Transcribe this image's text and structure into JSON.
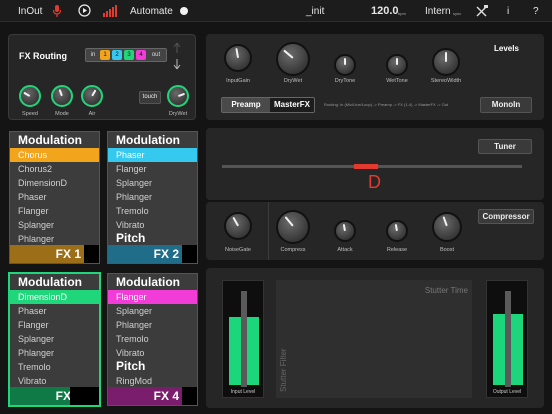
{
  "topbar": {
    "inout": "InOut",
    "automate": "Automate",
    "preset": "_init",
    "tempo": "120.0",
    "tempo_unit": "bpm",
    "sync": "Intern",
    "sync_sub": "sync",
    "info": "i",
    "help": "?"
  },
  "routing": {
    "title": "FX Routing",
    "in_label": "in",
    "out_label": "out",
    "slots": [
      "1",
      "2",
      "3",
      "4"
    ],
    "slot_colors": [
      "#f2a51c",
      "#35c9f0",
      "#1fd67a",
      "#f23cd8"
    ],
    "touch": "touch",
    "knobs": [
      "Speed",
      "Mode",
      "Air",
      "DryWet"
    ]
  },
  "levels": {
    "title": "Levels",
    "knobs": [
      "InputGain",
      "DryWet",
      "DryTone",
      "WetTone",
      "StereoWidth"
    ],
    "preamp": "Preamp",
    "masterfx": "MasterFX",
    "routing_text": "Routing: In (Mic/Line/Loop) -> Preamp -> FX (1-4) -> MasterFX -> Out",
    "monoin": "MonoIn"
  },
  "tuner": {
    "button": "Tuner",
    "note": "D"
  },
  "compressor": {
    "button": "Compressor",
    "knobs": [
      "NoiseGate",
      "Compress",
      "Attack",
      "Release",
      "Boost"
    ]
  },
  "fx1": {
    "header": "Modulation",
    "items": [
      "Chorus",
      "Chorus2",
      "DimensionD",
      "Phaser",
      "Flanger",
      "Splanger",
      "Phlanger"
    ],
    "selected": "Chorus",
    "footer": "FX 1",
    "color": "#f2a51c"
  },
  "fx2": {
    "header": "Modulation",
    "items": [
      "Phaser",
      "Flanger",
      "Splanger",
      "Phlanger",
      "Tremolo",
      "Vibrato"
    ],
    "sub_header": "Pitch",
    "selected": "Phaser",
    "footer": "FX 2",
    "color": "#35c9f0"
  },
  "fx3": {
    "header": "Modulation",
    "items": [
      "DimensionD",
      "Phaser",
      "Flanger",
      "Splanger",
      "Phlanger",
      "Tremolo",
      "Vibrato"
    ],
    "selected": "DimensionD",
    "footer": "FX 3",
    "color": "#1fd67a"
  },
  "fx4": {
    "header": "Modulation",
    "items": [
      "Flanger",
      "Splanger",
      "Phlanger",
      "Tremolo",
      "Vibrato"
    ],
    "sub_header": "Pitch",
    "sub_items": [
      "RingMod"
    ],
    "selected": "Flanger",
    "footer": "FX 4",
    "color": "#f23cd8"
  },
  "stutter": {
    "time": "Stutter Time",
    "filter": "Stutter Filter",
    "input_label": "Input Level",
    "output_label": "Output Level",
    "input_level": 0.72,
    "output_level": 0.76
  }
}
